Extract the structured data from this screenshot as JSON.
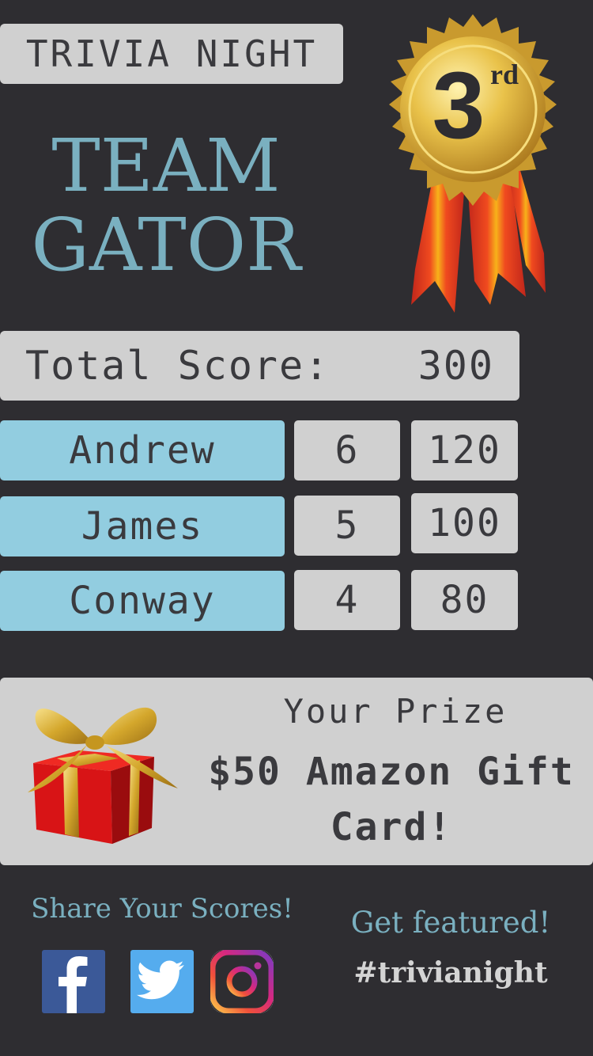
{
  "header": {
    "event_title": "TRIVIA NIGHT"
  },
  "team": {
    "name": "TEAM\nGATOR"
  },
  "medal": {
    "place_number": "3",
    "place_suffix": "rd",
    "icon": "medal-ribbon-icon"
  },
  "score": {
    "label": "Total Score:",
    "value": "300"
  },
  "players": [
    {
      "name": "Andrew",
      "correct": "6",
      "points": "120"
    },
    {
      "name": "James",
      "correct": "5",
      "points": "100"
    },
    {
      "name": "Conway",
      "correct": "4",
      "points": "80"
    }
  ],
  "prize": {
    "heading": "Your Prize",
    "description": "$50 Amazon Gift Card!",
    "icon": "gift-box-icon"
  },
  "share": {
    "heading": "Share Your Scores!",
    "networks": [
      "facebook",
      "twitter",
      "instagram"
    ]
  },
  "featured": {
    "heading": "Get featured!",
    "hashtag": "#trivianight"
  },
  "colors": {
    "background": "#2e2d31",
    "panel": "#d0d0d0",
    "accent_blue": "#92cde0",
    "team_text": "#7ab0c0",
    "facebook": "#3b5998",
    "twitter": "#55acee"
  }
}
